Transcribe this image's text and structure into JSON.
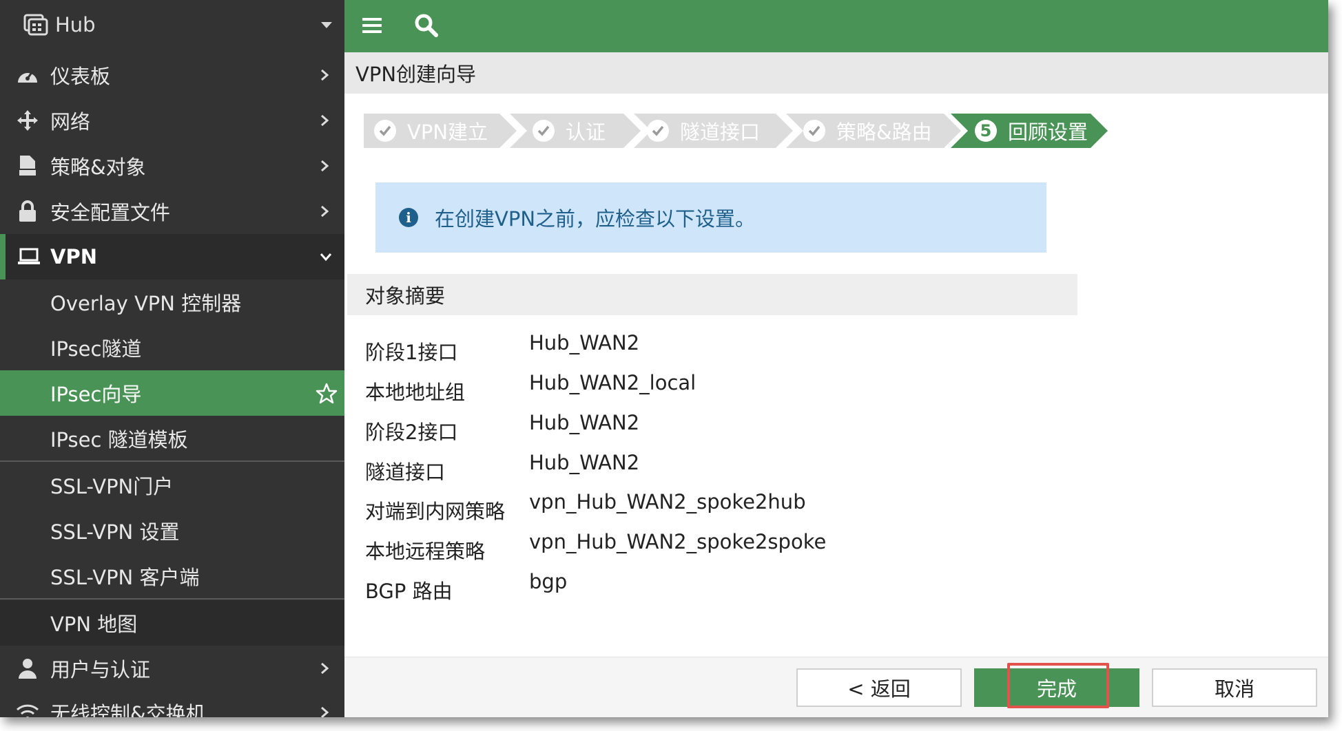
{
  "sidebar": {
    "header": "Hub",
    "items": [
      {
        "label": "仪表板",
        "icon": "dashboard-icon"
      },
      {
        "label": "网络",
        "icon": "network-icon"
      },
      {
        "label": "策略&对象",
        "icon": "policy-icon"
      },
      {
        "label": "安全配置文件",
        "icon": "lock-icon"
      },
      {
        "label": "VPN",
        "icon": "laptop-icon"
      }
    ],
    "vpn_sub": [
      {
        "label": "Overlay VPN 控制器"
      },
      {
        "label": "IPsec隧道"
      },
      {
        "label": "IPsec向导"
      },
      {
        "label": "IPsec 隧道模板"
      },
      {
        "label": "SSL-VPN门户"
      },
      {
        "label": "SSL-VPN 设置"
      },
      {
        "label": "SSL-VPN 客户端"
      },
      {
        "label": "VPN 地图"
      }
    ],
    "bottom_items": [
      {
        "label": "用户与认证",
        "icon": "user-icon"
      },
      {
        "label": "无线控制&交换机",
        "icon": "wifi-icon"
      }
    ]
  },
  "page_title": "VPN创建向导",
  "steps": [
    {
      "label": "VPN建立",
      "state": "done"
    },
    {
      "label": "认证",
      "state": "done"
    },
    {
      "label": "隧道接口",
      "state": "done"
    },
    {
      "label": "策略&路由",
      "state": "done"
    },
    {
      "label": "回顾设置",
      "state": "active",
      "number": "5"
    }
  ],
  "info_message": "在创建VPN之前，应检查以下设置。",
  "section_title": "对象摘要",
  "summary": [
    {
      "key": "阶段1接口",
      "value": "Hub_WAN2"
    },
    {
      "key": "本地地址组",
      "value": "Hub_WAN2_local"
    },
    {
      "key": "阶段2接口",
      "value": "Hub_WAN2"
    },
    {
      "key": "隧道接口",
      "value": "Hub_WAN2"
    },
    {
      "key": "对端到内网策略",
      "value": "vpn_Hub_WAN2_spoke2hub"
    },
    {
      "key": "本地远程策略",
      "value": "vpn_Hub_WAN2_spoke2spoke"
    },
    {
      "key": "BGP 路由",
      "value": "bgp"
    }
  ],
  "buttons": {
    "back": "< 返回",
    "finish": "完成",
    "cancel": "取消"
  },
  "colors": {
    "accent": "#4a9356",
    "sidebar": "#333333",
    "info_bg": "#cfe5fa",
    "highlight": "#e2534b",
    "step_inactive": "#dcdcdc"
  }
}
